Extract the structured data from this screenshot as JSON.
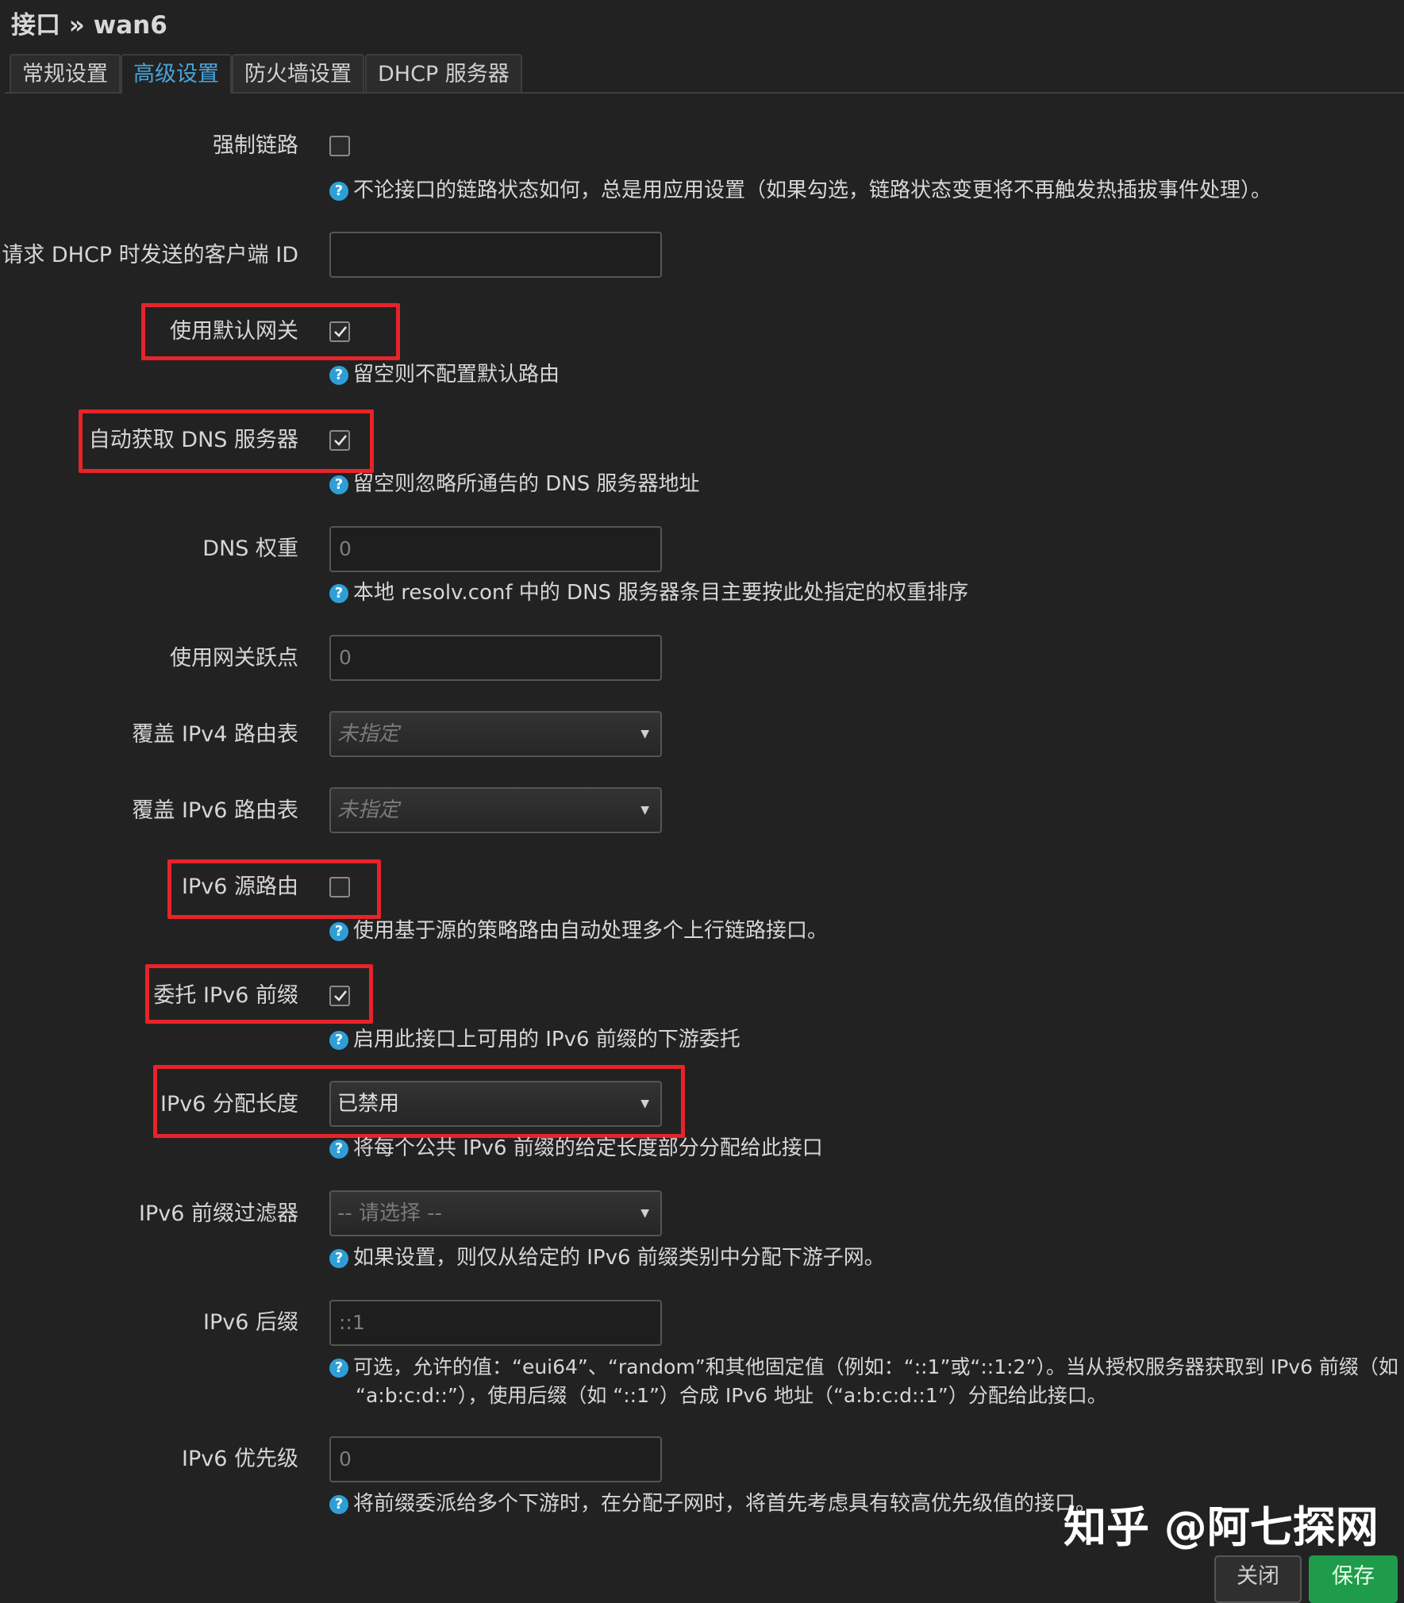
{
  "header": {
    "title": "接口 » wan6"
  },
  "tabs": [
    {
      "label": "常规设置",
      "active": false
    },
    {
      "label": "高级设置",
      "active": true
    },
    {
      "label": "防火墙设置",
      "active": false
    },
    {
      "label": "DHCP 服务器",
      "active": false
    }
  ],
  "fields": {
    "force_link": {
      "label": "强制链路",
      "checked": false,
      "help": "不论接口的链路状态如何，总是用应用设置（如果勾选，链路状态变更将不再触发热插拔事件处理）。"
    },
    "client_id": {
      "label": "请求 DHCP 时发送的客户端 ID",
      "value": ""
    },
    "default_gw": {
      "label": "使用默认网关",
      "checked": true,
      "help": "留空则不配置默认路由"
    },
    "peer_dns": {
      "label": "自动获取 DNS 服务器",
      "checked": true,
      "help": "留空则忽略所通告的 DNS 服务器地址"
    },
    "dns_weight": {
      "label": "DNS 权重",
      "placeholder": "0",
      "help": "本地 resolv.conf 中的 DNS 服务器条目主要按此处指定的权重排序"
    },
    "gw_metric": {
      "label": "使用网关跃点",
      "placeholder": "0"
    },
    "ipv4_table": {
      "label": "覆盖 IPv4 路由表",
      "value": "未指定"
    },
    "ipv6_table": {
      "label": "覆盖 IPv6 路由表",
      "value": "未指定"
    },
    "source_route": {
      "label": "IPv6 源路由",
      "checked": false,
      "help": "使用基于源的策略路由自动处理多个上行链路接口。"
    },
    "delegate": {
      "label": "委托 IPv6 前缀",
      "checked": true,
      "help": "启用此接口上可用的 IPv6 前缀的下游委托"
    },
    "assign_len": {
      "label": "IPv6 分配长度",
      "value": "已禁用",
      "help": "将每个公共 IPv6 前缀的给定长度部分分配给此接口"
    },
    "prefix_filter": {
      "label": "IPv6 前缀过滤器",
      "value": "-- 请选择 --",
      "help": "如果设置，则仅从给定的 IPv6 前缀类别中分配下游子网。"
    },
    "suffix": {
      "label": "IPv6 后缀",
      "placeholder": "::1",
      "help_line1": "可选，允许的值：“eui64”、“random”和其他固定值（例如：“::1”或“::1:2”）。当从授权服务器获取到 IPv6 前缀（如",
      "help_line2": "“a:b:c:d::”），使用后缀（如 “::1”）合成 IPv6 地址（“a:b:c:d::1”）分配给此接口。"
    },
    "priority": {
      "label": "IPv6 优先级",
      "placeholder": "0",
      "help": "将前缀委派给多个下游时，在分配子网时，将首先考虑具有较高优先级值的接口。"
    }
  },
  "help_icon": "question-circle-icon",
  "watermark": "知乎 @阿七探网",
  "buttons": {
    "close": "关闭",
    "save": "保存"
  },
  "colors": {
    "highlight": "#e8232a",
    "active_tab": "#48a3d9",
    "help_icon": "#2e9fd6",
    "save": "#1f9b4c"
  }
}
